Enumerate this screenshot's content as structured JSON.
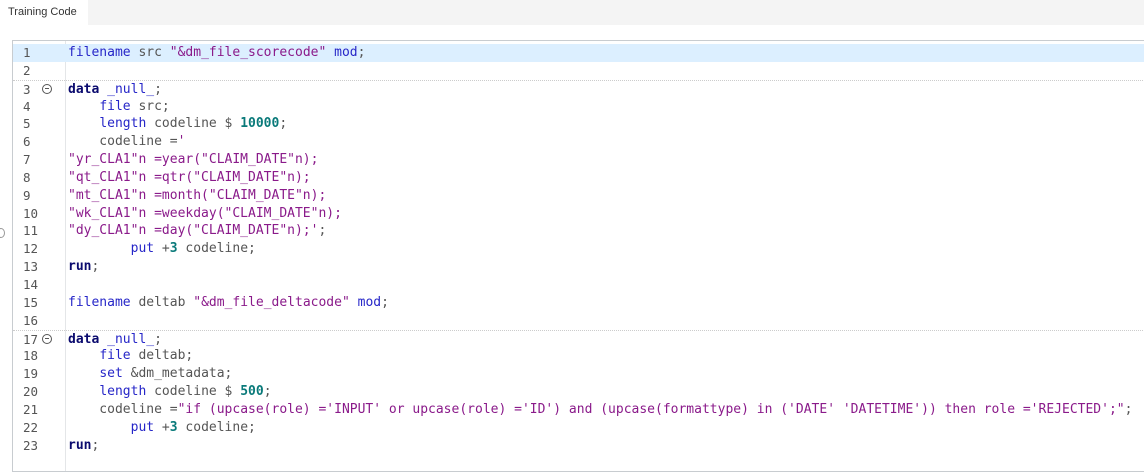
{
  "tab": {
    "label": "Training Code"
  },
  "editor": {
    "active_line": 1,
    "fold_lines": [
      3,
      17
    ],
    "separator_lines": [
      3,
      17
    ],
    "lines": [
      [
        {
          "c": "kw",
          "s": "filename"
        },
        {
          "c": "txt",
          "s": " src "
        },
        {
          "c": "str",
          "s": "\"&dm_file_scorecode\""
        },
        {
          "c": "txt",
          "s": " "
        },
        {
          "c": "kw",
          "s": "mod"
        },
        {
          "c": "txt",
          "s": ";"
        }
      ],
      [],
      [
        {
          "c": "kb",
          "s": "data"
        },
        {
          "c": "txt",
          "s": " "
        },
        {
          "c": "kw",
          "s": "_null_"
        },
        {
          "c": "txt",
          "s": ";"
        }
      ],
      [
        {
          "c": "txt",
          "s": "    "
        },
        {
          "c": "kw",
          "s": "file"
        },
        {
          "c": "txt",
          "s": " src;"
        }
      ],
      [
        {
          "c": "txt",
          "s": "    "
        },
        {
          "c": "kw",
          "s": "length"
        },
        {
          "c": "txt",
          "s": " codeline $ "
        },
        {
          "c": "num",
          "s": "10000"
        },
        {
          "c": "txt",
          "s": ";"
        }
      ],
      [
        {
          "c": "txt",
          "s": "    codeline ="
        },
        {
          "c": "str",
          "s": "'"
        }
      ],
      [
        {
          "c": "str",
          "s": "\"yr_CLA1\"n =year(\"CLAIM_DATE\"n);"
        }
      ],
      [
        {
          "c": "str",
          "s": "\"qt_CLA1\"n =qtr(\"CLAIM_DATE\"n);"
        }
      ],
      [
        {
          "c": "str",
          "s": "\"mt_CLA1\"n =month(\"CLAIM_DATE\"n);"
        }
      ],
      [
        {
          "c": "str",
          "s": "\"wk_CLA1\"n =weekday(\"CLAIM_DATE\"n);"
        }
      ],
      [
        {
          "c": "str",
          "s": "\"dy_CLA1\"n =day(\"CLAIM_DATE\"n);'"
        },
        {
          "c": "txt",
          "s": ";"
        }
      ],
      [
        {
          "c": "txt",
          "s": "        "
        },
        {
          "c": "kw",
          "s": "put"
        },
        {
          "c": "txt",
          "s": " +"
        },
        {
          "c": "num",
          "s": "3"
        },
        {
          "c": "txt",
          "s": " codeline;"
        }
      ],
      [
        {
          "c": "kb",
          "s": "run"
        },
        {
          "c": "txt",
          "s": ";"
        }
      ],
      [],
      [
        {
          "c": "kw",
          "s": "filename"
        },
        {
          "c": "txt",
          "s": " deltab "
        },
        {
          "c": "str",
          "s": "\"&dm_file_deltacode\""
        },
        {
          "c": "txt",
          "s": " "
        },
        {
          "c": "kw",
          "s": "mod"
        },
        {
          "c": "txt",
          "s": ";"
        }
      ],
      [],
      [
        {
          "c": "kb",
          "s": "data"
        },
        {
          "c": "txt",
          "s": " "
        },
        {
          "c": "kw",
          "s": "_null_"
        },
        {
          "c": "txt",
          "s": ";"
        }
      ],
      [
        {
          "c": "txt",
          "s": "    "
        },
        {
          "c": "kw",
          "s": "file"
        },
        {
          "c": "txt",
          "s": " deltab;"
        }
      ],
      [
        {
          "c": "txt",
          "s": "    "
        },
        {
          "c": "kw",
          "s": "set"
        },
        {
          "c": "txt",
          "s": " &dm_metadata;"
        }
      ],
      [
        {
          "c": "txt",
          "s": "    "
        },
        {
          "c": "kw",
          "s": "length"
        },
        {
          "c": "txt",
          "s": " codeline $ "
        },
        {
          "c": "num",
          "s": "500"
        },
        {
          "c": "txt",
          "s": ";"
        }
      ],
      [
        {
          "c": "txt",
          "s": "    codeline ="
        },
        {
          "c": "str",
          "s": "\"if (upcase(role) ='INPUT' or upcase(role) ='ID') and (upcase(formattype) in ('DATE' 'DATETIME')) then role ='REJECTED';\""
        },
        {
          "c": "txt",
          "s": ";"
        }
      ],
      [
        {
          "c": "txt",
          "s": "        "
        },
        {
          "c": "kw",
          "s": "put"
        },
        {
          "c": "txt",
          "s": " +"
        },
        {
          "c": "num",
          "s": "3"
        },
        {
          "c": "txt",
          "s": " codeline;"
        }
      ],
      [
        {
          "c": "kb",
          "s": "run"
        },
        {
          "c": "txt",
          "s": ";"
        }
      ]
    ]
  }
}
